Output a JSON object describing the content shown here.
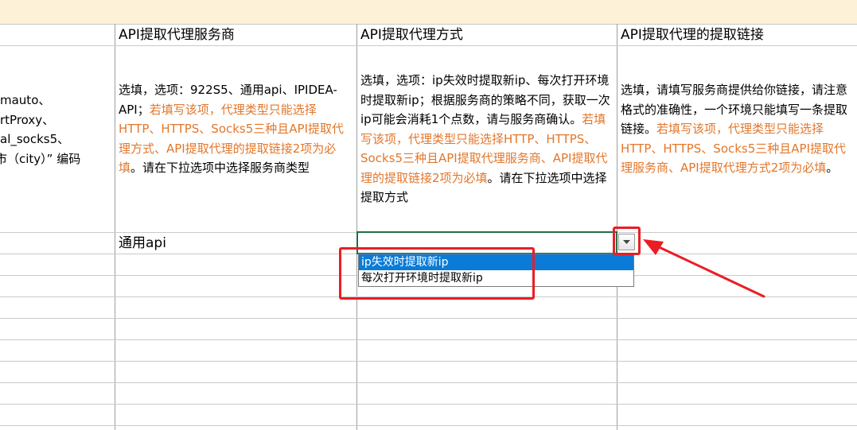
{
  "headers": {
    "col2": "API提取代理服务商",
    "col3": "API提取代理方式",
    "col4": "API提取代理的提取链接"
  },
  "col1_desc_lines": [
    "mauto、",
    "rtProxy、",
    "al_socks5、",
    "市（city）” 编码"
  ],
  "col2_desc": {
    "p1": "选填，选项：922S5、通用api、IPIDEA-API；",
    "p2": "若填写该项，代理类型只能选择HTTP、HTTPS、Socks5三种且API提取代理方式、API提取代理的提取链接2项为必填",
    "p3": "。请在下拉选项中选择服务商类型"
  },
  "col3_desc": {
    "p1": "选填，选项：ip失效时提取新ip、每次打开环境时提取新ip；根据服务商的策略不同，获取一次ip可能会消耗1个点数，请与服务商确认。",
    "p2": "若填写该项，代理类型只能选择HTTP、HTTPS、Socks5三种且API提取代理服务商、API提取代理的提取链接2项为必填",
    "p3": "。请在下拉选项中选择提取方式"
  },
  "col4_desc": {
    "p1": "选填，请填写服务商提供给你链接，请注意格式的准确性，一个环境只能填写一条提取链接。",
    "p2": "若填写该项，代理类型只能选择HTTP、HTTPS、Socks5三种且API提取代理服务商、API提取代理方式2项为必填",
    "p3": "。"
  },
  "row_values": {
    "col2": "通用api"
  },
  "dropdown": {
    "options": [
      "ip失效时提取新ip",
      "每次打开环境时提取新ip"
    ],
    "selected_index": 0,
    "button_icon": "chevron-down-icon"
  },
  "colors": {
    "header_band": "#fdf1d8",
    "orange_text": "#e2772b",
    "selection_blue": "#0a7bd6",
    "annotation_red": "#ea1d25",
    "cell_border_green": "#1e7145"
  }
}
